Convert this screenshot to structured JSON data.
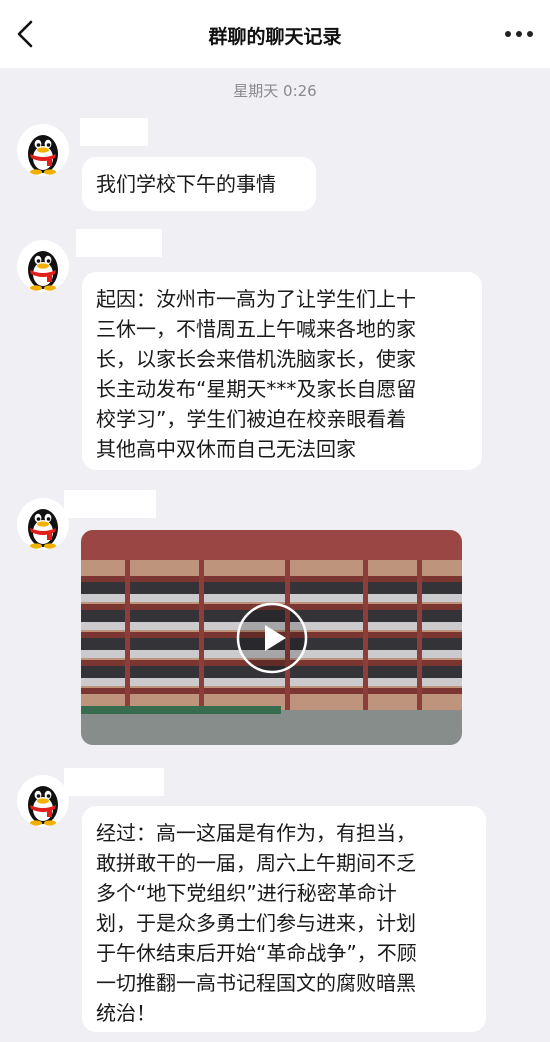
{
  "header": {
    "title": "群聊的聊天记录",
    "back_icon": "chevron-left-icon",
    "more_icon": "more-dots-icon"
  },
  "timestamp": "星期天 0:26",
  "messages": [
    {
      "type": "text",
      "text": "我们学校下午的事情"
    },
    {
      "type": "text",
      "text": "起因：汝州市一高为了让学生们上十\n三休一，不惜周五上午喊来各地的家\n长，以家长会来借机洗脑家长，使家\n长主动发布“星期天***及家长自愿留\n校学习”，学生们被迫在校亲眼看着\n其他高中双休而自己无法回家"
    },
    {
      "type": "video",
      "icon": "play-icon"
    },
    {
      "type": "text",
      "text": "经过：高一这届是有作为，有担当，\n敢拼敢干的一届，周六上午期间不乏\n多个“地下党组织”进行秘密革命计\n划，于是众多勇士们参与进来，计划\n于午休结束后开始“革命战争”，不顾\n一切推翻一高书记程国文的腐败暗黑\n统治！"
    }
  ]
}
